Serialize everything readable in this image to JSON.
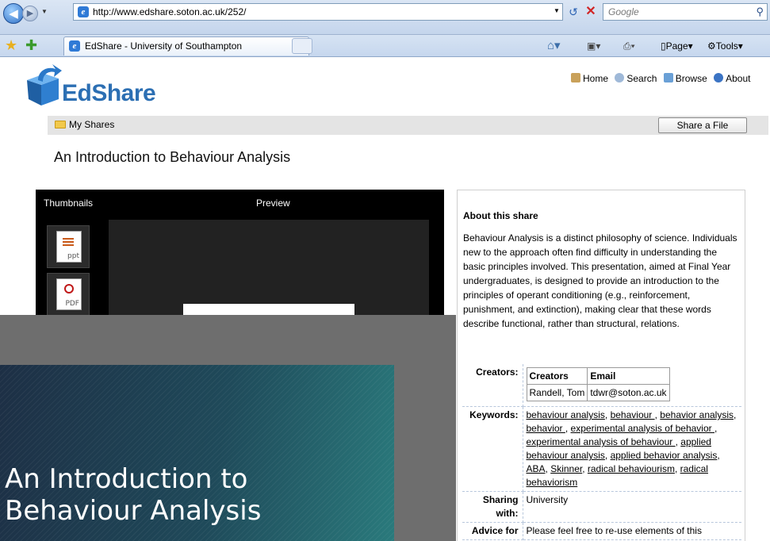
{
  "browser": {
    "url": "http://www.edshare.soton.ac.uk/252/",
    "search_placeholder": "Google",
    "tab_title": "EdShare - University of Southampton",
    "cmd_page": "Page",
    "cmd_tools": "Tools"
  },
  "site": {
    "logo_text": "EdShare",
    "nav": [
      "Home",
      "Search",
      "Browse",
      "About"
    ],
    "my_shares": "My Shares",
    "share_button": "Share a File"
  },
  "page_title": "An Introduction to Behaviour Analysis",
  "viewer": {
    "thumbnails_label": "Thumbnails",
    "preview_label": "Preview",
    "thumbs": [
      "ppt",
      "PDF"
    ]
  },
  "about": {
    "heading": "About this share",
    "description": "Behaviour Analysis is a distinct philosophy of science. Individuals new to the approach often find difficulty in understanding the basic principles involved. This presentation, aimed at Final Year undergraduates, is designed to provide an introduction to the principles of operant conditioning (e.g., reinforcement, punishment, and extinction), making clear that these words describe functional, rather than structural, relations.",
    "creators_label": "Creators:",
    "creators_table": {
      "headers": [
        "Creators",
        "Email"
      ],
      "rows": [
        [
          "Randell, Tom",
          "tdwr@soton.ac.uk"
        ]
      ]
    },
    "keywords_label": "Keywords:",
    "keywords": [
      "behaviour analysis",
      "behaviour ",
      "behavior analysis",
      "behavior ",
      "experimental analysis of behavior ",
      "experimental analysis of behaviour ",
      "applied behaviour analysis",
      "applied behavior analysis",
      "ABA",
      "Skinner",
      "radical behaviourism",
      "radical behaviorism"
    ],
    "sharing_label": "Sharing with:",
    "sharing_value": "University",
    "advice_label": "Advice for",
    "advice_value": "Please feel free to re-use elements of this"
  },
  "slide": {
    "title_line1": "An Introduction to",
    "title_line2": "Behaviour Analysis"
  }
}
